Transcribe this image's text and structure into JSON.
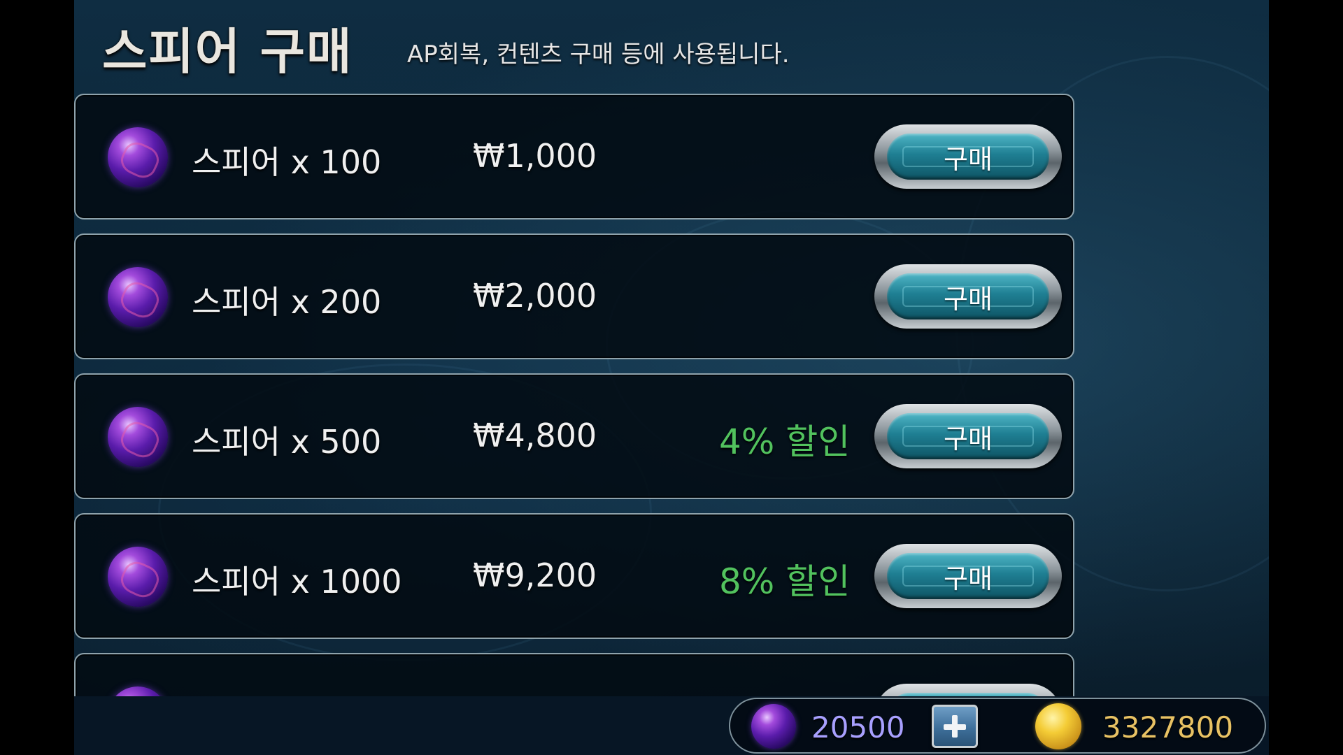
{
  "header": {
    "title": "스피어 구매",
    "subtitle": "AP회복, 컨텐츠 구매 등에 사용됩니다."
  },
  "products": [
    {
      "name": "스피어 x 100",
      "price": "₩1,000",
      "discount": "",
      "buy_label": "구매",
      "icon": "spear-orb-icon"
    },
    {
      "name": "스피어 x 200",
      "price": "₩2,000",
      "discount": "",
      "buy_label": "구매",
      "icon": "spear-orb-icon"
    },
    {
      "name": "스피어 x 500",
      "price": "₩4,800",
      "discount": "4% 할인",
      "buy_label": "구매",
      "icon": "spear-orb-icon"
    },
    {
      "name": "스피어 x 1000",
      "price": "₩9,200",
      "discount": "8% 할인",
      "buy_label": "구매",
      "icon": "spear-orb-icon"
    },
    {
      "name": "",
      "price": "",
      "discount": "",
      "buy_label": "",
      "icon": "spear-orb-icon"
    }
  ],
  "currency": {
    "spear_amount": "20500",
    "gold_amount": "3327800",
    "spear_icon": "spear-orb-icon",
    "add_icon": "plus-icon",
    "gold_icon": "gold-coin-icon"
  },
  "colors": {
    "discount": "#52c25e",
    "spear_amount": "#a8a0ff",
    "gold_amount": "#e8c264"
  }
}
